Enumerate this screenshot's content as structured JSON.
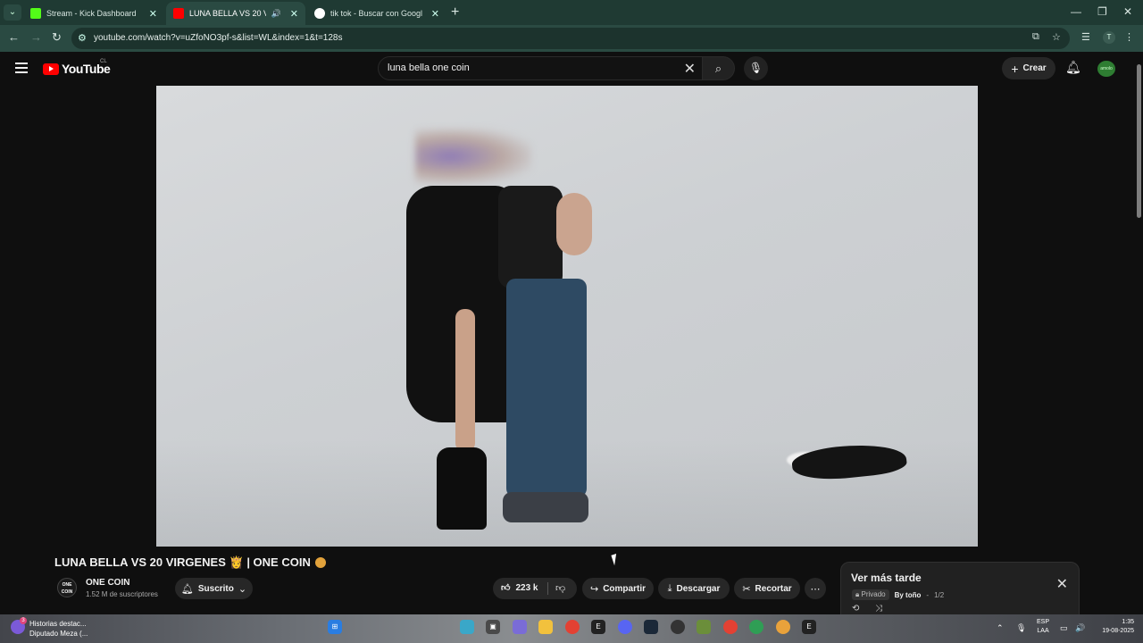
{
  "browser": {
    "tabs": [
      {
        "title": "Stream - Kick Dashboard",
        "favicon": "kick-icon",
        "active": false
      },
      {
        "title": "LUNA BELLA VS 20 VIRGENES",
        "favicon": "youtube-icon",
        "active": true
      },
      {
        "title": "tik tok - Buscar con Google",
        "favicon": "google-icon",
        "active": false
      }
    ],
    "url": "youtube.com/watch?v=uZfoNO3pf-s&list=WL&index=1&t=128s"
  },
  "youtube": {
    "logo_text": "YouTube",
    "country_code": "CL",
    "search_value": "luna bella one coin",
    "create_label": "Crear",
    "avatar_text": "amolo"
  },
  "video": {
    "title": "LUNA BELLA VS 20 VIRGENES 👸 | ONE COIN",
    "channel_logo": "ONE COIN",
    "channel_name": "ONE COIN",
    "subscribers": "1.52 M de suscriptores",
    "subscribe_label": "Suscrito",
    "likes": "223 k",
    "share_label": "Compartir",
    "download_label": "Descargar",
    "clip_label": "Recortar"
  },
  "watch_later": {
    "title": "Ver más tarde",
    "privacy": "Privado",
    "owner": "By toño",
    "position": "1/2"
  },
  "taskbar": {
    "news_badge": "3",
    "news_line1": "Historias destac...",
    "news_line2": "Diputado Meza (...",
    "lang_line1": "ESP",
    "lang_line2": "LAA",
    "time": "1:35",
    "date": "19-08-2025"
  },
  "colors": {
    "accent_red": "#ff0000",
    "browser_frame": "#1f3a33",
    "background": "#0f0f0f"
  }
}
